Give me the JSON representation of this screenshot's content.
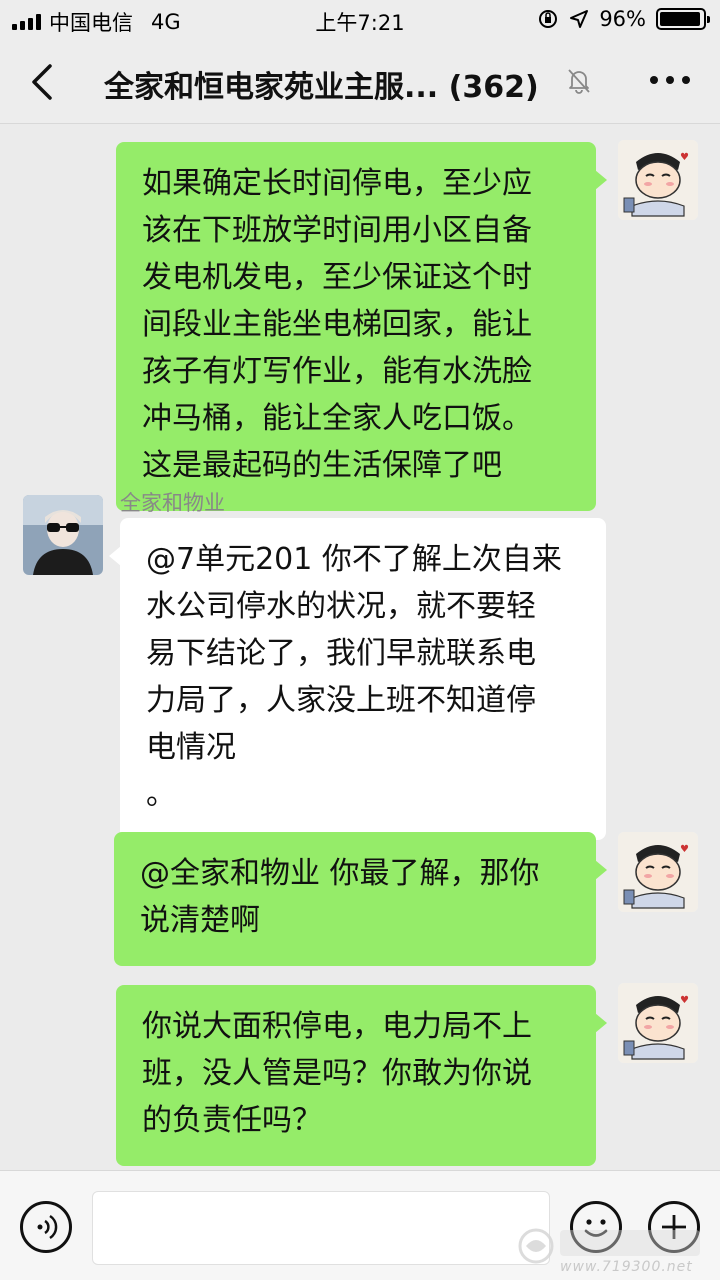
{
  "status_bar": {
    "carrier": "中国电信",
    "network": "4G",
    "time": "上午7:21",
    "battery_percent": "96%",
    "battery_level": 0.96
  },
  "nav": {
    "title": "全家和恒电家苑业主服... (362)",
    "back_icon": "chevron-left-icon",
    "mute_icon": "bell-slash-icon",
    "more_icon": "more-dots-icon"
  },
  "messages": [
    {
      "from": "me",
      "text": "如果确定长时间停电，至少应\n该在下班放学时间用小区自备\n发电机发电，至少保证这个时\n间段业主能坐电梯回家，能让\n孩子有灯写作业，能有水洗脸\n冲马桶，能让全家人吃口饭。\n这是最起码的生活保障了吧"
    },
    {
      "from": "other",
      "sender": "全家和物业",
      "text": "@7单元201 你不了解上次自来\n水公司停水的状况，就不要轻\n易下结论了，我们早就联系电\n力局了，人家没上班不知道停\n电情况\n。"
    },
    {
      "from": "me",
      "text": "@全家和物业 你最了解，那你\n说清楚啊"
    },
    {
      "from": "me",
      "text": "你说大面积停电，电力局不上\n班，没人管是吗？你敢为你说\n的负责任吗？"
    }
  ],
  "input_bar": {
    "voice_icon": "voice-icon",
    "emoji_icon": "emoji-icon",
    "plus_icon": "plus-icon"
  },
  "watermark": {
    "text": "www.719300.net"
  },
  "colors": {
    "my_bubble": "#95ec69",
    "other_bubble": "#ffffff",
    "background": "#ebebeb"
  }
}
